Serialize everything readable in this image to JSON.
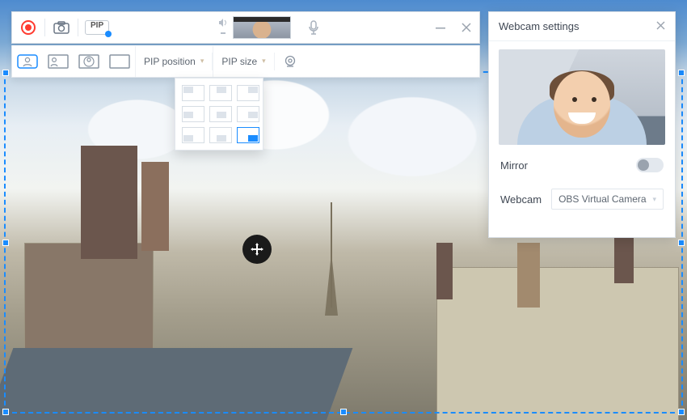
{
  "toolbar": {
    "record_label": "Record",
    "camera_label": "Screenshot",
    "pip_label": "PIP",
    "minimize_label": "Minimize",
    "close_label": "Close"
  },
  "subtoolbar": {
    "pip_position_label": "PIP position",
    "pip_size_label": "PIP size"
  },
  "pip_grid": {
    "selected_index": 8
  },
  "settings": {
    "title": "Webcam settings",
    "mirror_label": "Mirror",
    "mirror_on": false,
    "webcam_label": "Webcam",
    "webcam_value": "OBS Virtual Camera"
  },
  "colors": {
    "accent": "#1a8cff",
    "record": "#ff3b30"
  }
}
